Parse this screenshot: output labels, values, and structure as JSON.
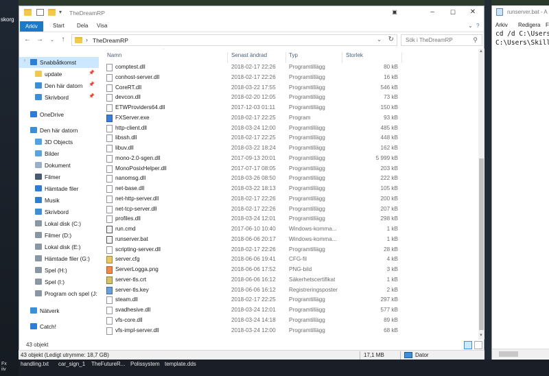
{
  "desktop": {
    "left_label": "skorg",
    "fx_lines": [
      "Fx",
      "iiv"
    ],
    "taskbar_files": [
      "handling.txt",
      "car_sign_1",
      "TheFutureR...",
      "Polissystem",
      "template.dds"
    ]
  },
  "explorer": {
    "title": "TheDreamRP",
    "ribbon_tabs": [
      {
        "label": "Arkiv",
        "active": true
      },
      {
        "label": "Start"
      },
      {
        "label": "Dela"
      },
      {
        "label": "Visa"
      }
    ],
    "breadcrumb": "TheDreamRP",
    "search_placeholder": "Sök i TheDreamRP",
    "columns": {
      "name": "Namn",
      "modified": "Senast ändrad",
      "type": "Typ",
      "size": "Storlek"
    },
    "nav": [
      {
        "label": "Snabbåtkomst",
        "icon": "star-icon",
        "color": "#2d7fd6",
        "indent": 1,
        "selected": true,
        "chev": true
      },
      {
        "label": "update",
        "icon": "folder-icon",
        "color": "#f3c94a",
        "indent": 2,
        "pin": true
      },
      {
        "label": "Den här datorn",
        "icon": "desktop-icon",
        "color": "#3c8fd6",
        "indent": 2,
        "pin": true
      },
      {
        "label": "Skrivbord",
        "icon": "desktop-icon",
        "color": "#3c8fd6",
        "indent": 2,
        "pin": true
      },
      {
        "label": "OneDrive",
        "icon": "cloud-icon",
        "color": "#2f7bd3",
        "indent": 1
      },
      {
        "label": "Den här datorn",
        "icon": "computer-icon",
        "color": "#3c8fd6",
        "indent": 1
      },
      {
        "label": "3D Objects",
        "icon": "cube-icon",
        "color": "#4fa3e8",
        "indent": 2
      },
      {
        "label": "Bilder",
        "icon": "pictures-icon",
        "color": "#5ba4df",
        "indent": 2
      },
      {
        "label": "Dokument",
        "icon": "documents-icon",
        "color": "#9ab0c8",
        "indent": 2
      },
      {
        "label": "Filmer",
        "icon": "film-icon",
        "color": "#4a5a70",
        "indent": 2
      },
      {
        "label": "Hämtade filer",
        "icon": "download-icon",
        "color": "#2d7fd6",
        "indent": 2
      },
      {
        "label": "Musik",
        "icon": "music-icon",
        "color": "#2d7fd6",
        "indent": 2
      },
      {
        "label": "Skrivbord",
        "icon": "desktop-icon",
        "color": "#3c8fd6",
        "indent": 2
      },
      {
        "label": "Lokal disk (C:)",
        "icon": "drive-icon",
        "color": "#8a96a4",
        "indent": 2
      },
      {
        "label": "Filmer (D:)",
        "icon": "drive-icon",
        "color": "#8a96a4",
        "indent": 2
      },
      {
        "label": "Lokal disk (E:)",
        "icon": "drive-icon",
        "color": "#8a96a4",
        "indent": 2
      },
      {
        "label": "Hämtade filer (G:)",
        "icon": "drive-icon",
        "color": "#8a96a4",
        "indent": 2
      },
      {
        "label": "Spel (H:)",
        "icon": "drive-icon",
        "color": "#8a96a4",
        "indent": 2
      },
      {
        "label": "Spel (I:)",
        "icon": "drive-icon",
        "color": "#8a96a4",
        "indent": 2
      },
      {
        "label": "Program och spel (J:",
        "icon": "drive-icon",
        "color": "#8a96a4",
        "indent": 2
      },
      {
        "label": "Nätverk",
        "icon": "network-icon",
        "color": "#3c8fd6",
        "indent": 1
      },
      {
        "label": "Catch!",
        "icon": "catch-icon",
        "color": "#2d7fd6",
        "indent": 1
      }
    ],
    "files": [
      {
        "name": "comptest.dll",
        "date": "2018-02-17 22:26",
        "type": "Programtillägg",
        "size": "80 kB",
        "icon": "dll"
      },
      {
        "name": "conhost-server.dll",
        "date": "2018-02-17 22:26",
        "type": "Programtillägg",
        "size": "16 kB",
        "icon": "dll"
      },
      {
        "name": "CoreRT.dll",
        "date": "2018-03-22 17:55",
        "type": "Programtillägg",
        "size": "546 kB",
        "icon": "dll"
      },
      {
        "name": "devcon.dll",
        "date": "2018-02-20 12:05",
        "type": "Programtillägg",
        "size": "73 kB",
        "icon": "dll"
      },
      {
        "name": "ETWProviders64.dll",
        "date": "2017-12-03 01:11",
        "type": "Programtillägg",
        "size": "150 kB",
        "icon": "dll"
      },
      {
        "name": "FXServer.exe",
        "date": "2018-02-17 22:25",
        "type": "Program",
        "size": "93 kB",
        "icon": "exe"
      },
      {
        "name": "http-client.dll",
        "date": "2018-03-24 12:00",
        "type": "Programtillägg",
        "size": "485 kB",
        "icon": "dll"
      },
      {
        "name": "libssh.dll",
        "date": "2018-02-17 22:25",
        "type": "Programtillägg",
        "size": "448 kB",
        "icon": "dll"
      },
      {
        "name": "libuv.dll",
        "date": "2018-03-22 18:24",
        "type": "Programtillägg",
        "size": "162 kB",
        "icon": "dll"
      },
      {
        "name": "mono-2.0-sgen.dll",
        "date": "2017-09-13 20:01",
        "type": "Programtillägg",
        "size": "5 999 kB",
        "icon": "dll"
      },
      {
        "name": "MonoPosixHelper.dll",
        "date": "2017-07-17 08:05",
        "type": "Programtillägg",
        "size": "203 kB",
        "icon": "dll"
      },
      {
        "name": "nanomsg.dll",
        "date": "2018-03-26 08:50",
        "type": "Programtillägg",
        "size": "222 kB",
        "icon": "dll"
      },
      {
        "name": "net-base.dll",
        "date": "2018-03-22 18:13",
        "type": "Programtillägg",
        "size": "105 kB",
        "icon": "dll"
      },
      {
        "name": "net-http-server.dll",
        "date": "2018-02-17 22:26",
        "type": "Programtillägg",
        "size": "200 kB",
        "icon": "dll"
      },
      {
        "name": "net-tcp-server.dll",
        "date": "2018-02-17 22:26",
        "type": "Programtillägg",
        "size": "207 kB",
        "icon": "dll"
      },
      {
        "name": "profiles.dll",
        "date": "2018-03-24 12:01",
        "type": "Programtillägg",
        "size": "298 kB",
        "icon": "dll"
      },
      {
        "name": "run.cmd",
        "date": "2017-06-10 10:40",
        "type": "Windows-komma...",
        "size": "1 kB",
        "icon": "cmd"
      },
      {
        "name": "runserver.bat",
        "date": "2018-06-06 20:17",
        "type": "Windows-komma...",
        "size": "1 kB",
        "icon": "cmd"
      },
      {
        "name": "scripting-server.dll",
        "date": "2018-02-17 22:26",
        "type": "Programtillägg",
        "size": "28 kB",
        "icon": "dll"
      },
      {
        "name": "server.cfg",
        "date": "2018-06-06 19:41",
        "type": "CFG-fil",
        "size": "4 kB",
        "icon": "cfg"
      },
      {
        "name": "ServerLogga.png",
        "date": "2018-06-06 17:52",
        "type": "PNG-bild",
        "size": "3 kB",
        "icon": "png"
      },
      {
        "name": "server-tls.crt",
        "date": "2018-06-06 16:12",
        "type": "Säkerhetscertifikat",
        "size": "1 kB",
        "icon": "crt"
      },
      {
        "name": "server-tls.key",
        "date": "2018-06-06 16:12",
        "type": "Registreringsposter",
        "size": "2 kB",
        "icon": "key"
      },
      {
        "name": "steam.dll",
        "date": "2018-02-17 22:25",
        "type": "Programtillägg",
        "size": "297 kB",
        "icon": "dll"
      },
      {
        "name": "svadhesive.dll",
        "date": "2018-03-24 12:01",
        "type": "Programtillägg",
        "size": "577 kB",
        "icon": "dll"
      },
      {
        "name": "vfs-core.dll",
        "date": "2018-03-24 14:18",
        "type": "Programtillägg",
        "size": "89 kB",
        "icon": "dll"
      },
      {
        "name": "vfs-impl-server.dll",
        "date": "2018-03-24 12:00",
        "type": "Programtillägg",
        "size": "68 kB",
        "icon": "dll"
      }
    ],
    "item_count": "43 objekt",
    "status_free": "43 objekt (Ledigt utrymme: 18,7 GB)",
    "status_size": "17,1 MB",
    "status_location": "Dator"
  },
  "notepad": {
    "title": "runserver.bat - A",
    "menu": [
      "Arkiv",
      "Redigera",
      "Fo"
    ],
    "lines": [
      "cd /d C:\\Users",
      "C:\\Users\\Skill"
    ]
  }
}
